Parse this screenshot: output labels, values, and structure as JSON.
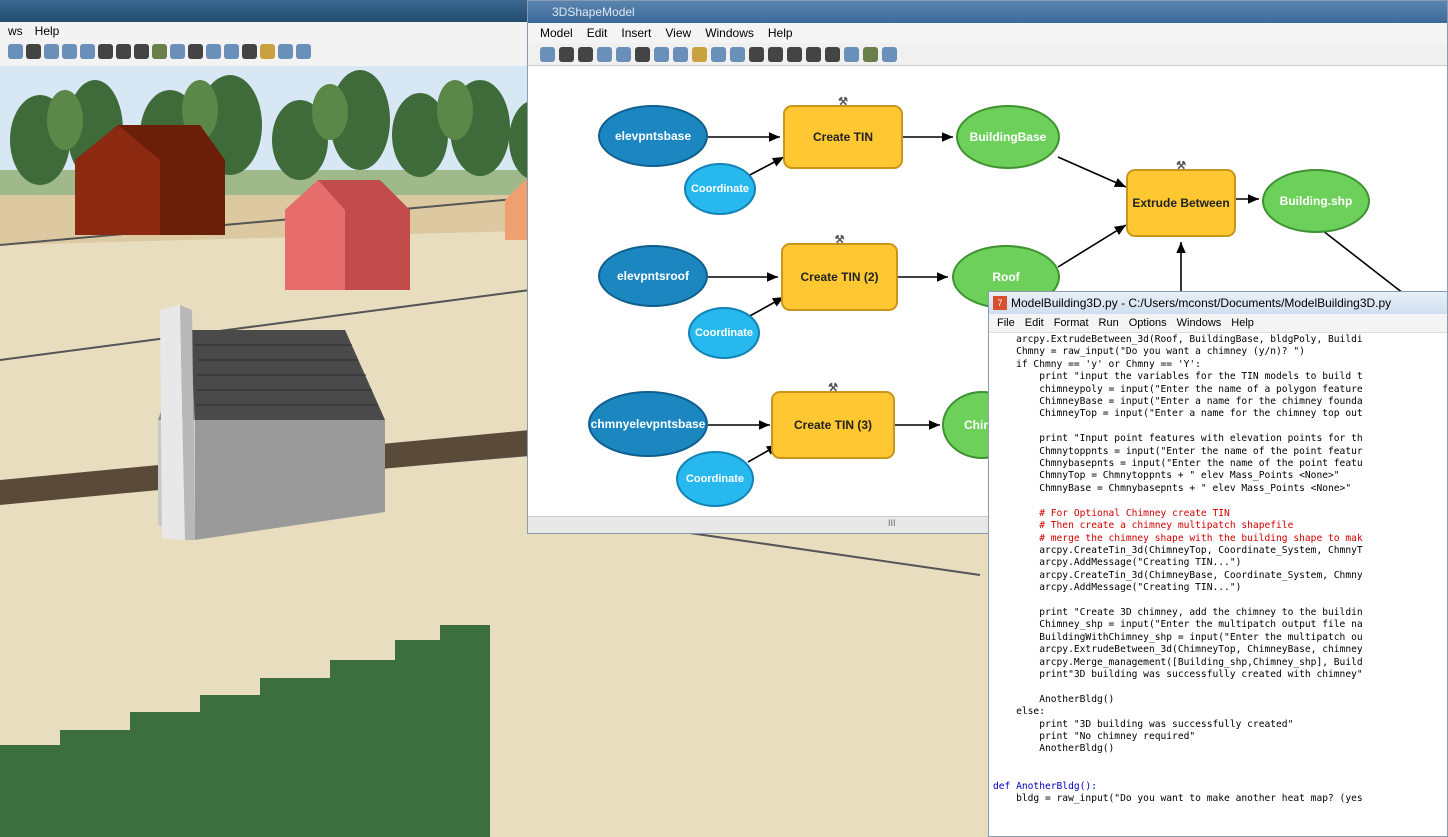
{
  "scene": {
    "menu": [
      "ws",
      "Help"
    ]
  },
  "model_window": {
    "title": "3DShapeModel",
    "menu": [
      "Model",
      "Edit",
      "Insert",
      "View",
      "Windows",
      "Help"
    ],
    "nodes": {
      "elev_base": "elevpntsbase",
      "coord1": "Coordinate",
      "create_tin": "Create TIN",
      "building_base": "BuildingBase",
      "extrude": "Extrude Between",
      "building_shp": "Building.shp",
      "elev_roof": "elevpntsroof",
      "coord2": "Coordinate",
      "create_tin2": "Create TIN (2)",
      "roof": "Roof",
      "chmny": "chmnyelevpntsbase",
      "coord3": "Coordinate",
      "create_tin3": "Create TIN (3)",
      "chim": "Chim"
    },
    "scroll_label": "III"
  },
  "editor": {
    "title": "ModelBuilding3D.py - C:/Users/mconst/Documents/ModelBuilding3D.py",
    "menu": [
      "File",
      "Edit",
      "Format",
      "Run",
      "Options",
      "Windows",
      "Help"
    ],
    "code_lines": [
      "    arcpy.ExtrudeBetween_3d(Roof, BuildingBase, bldgPoly, Buildi",
      "    Chmny = raw_input(\"Do you want a chimney (y/n)? \")",
      "    if Chmny == 'y' or Chmny == 'Y':",
      "        print \"input the variables for the TIN models to build t",
      "        chimneypoly = input(\"Enter the name of a polygon feature",
      "        ChimneyBase = input(\"Enter a name for the chimney founda",
      "        ChimneyTop = input(\"Enter a name for the chimney top out",
      "",
      "        print \"Input point features with elevation points for th",
      "        Chmnytoppnts = input(\"Enter the name of the point featur",
      "        Chmnybasepnts = input(\"Enter the name of the point featu",
      "        ChmnyTop = Chmnytoppnts + \" elev Mass_Points <None>\"",
      "        ChmnyBase = Chmnybasepnts + \" elev Mass_Points <None>\"",
      "",
      "        # For Optional Chimney create TIN",
      "        # Then create a chimney multipatch shapefile",
      "        # merge the chimney shape with the building shape to mak",
      "        arcpy.CreateTin_3d(ChimneyTop, Coordinate_System, ChmnyT",
      "        arcpy.AddMessage(\"Creating TIN...\")",
      "        arcpy.CreateTin_3d(ChimneyBase, Coordinate_System, Chmny",
      "        arcpy.AddMessage(\"Creating TIN...\")",
      "",
      "        print \"Create 3D chimney, add the chimney to the buildin",
      "        Chimney_shp = input(\"Enter the multipatch output file na",
      "        BuildingWithChimney_shp = input(\"Enter the multipatch ou",
      "        arcpy.ExtrudeBetween_3d(ChimneyTop, ChimneyBase, chimney",
      "        arcpy.Merge_management([Building_shp,Chimney_shp], Build",
      "        print\"3D building was successfully created with chimney\"",
      "",
      "        AnotherBldg()",
      "    else:",
      "        print \"3D building was successfully created\"",
      "        print \"No chimney required\"",
      "        AnotherBldg()",
      "",
      "",
      "def AnotherBldg():",
      "    bldg = raw_input(\"Do you want to make another heat map? (yes"
    ]
  }
}
